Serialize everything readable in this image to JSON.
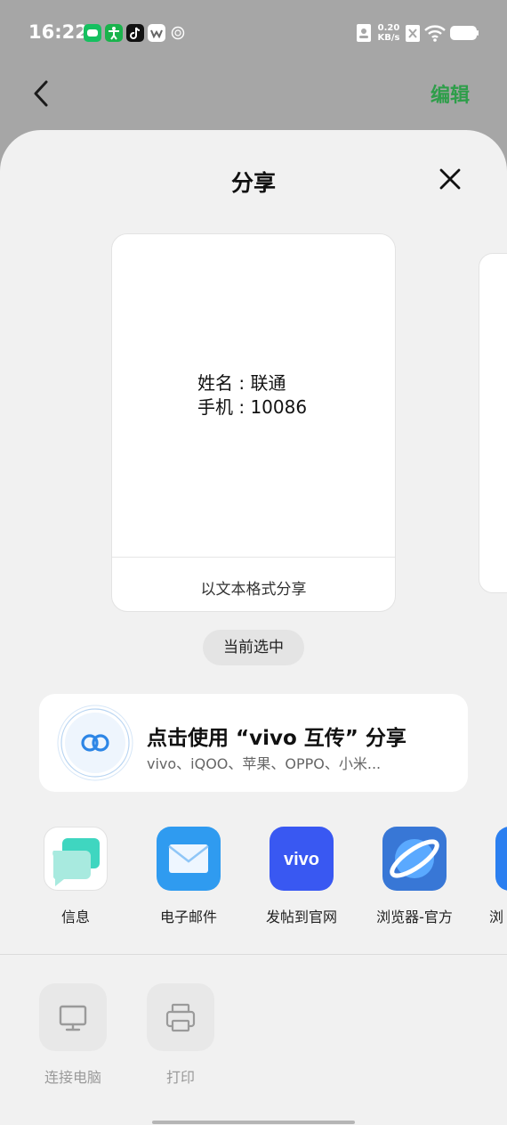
{
  "status_bar": {
    "time": "16:22",
    "net_speed_value": "0.20",
    "net_speed_unit": "KB/s",
    "app_icons": [
      "wechat-icon",
      "accessibility-icon",
      "tiktok-icon",
      "app-icon",
      "alarm-icon"
    ],
    "right_icons": [
      "contact-card-icon",
      "sim-x-icon",
      "wifi-icon",
      "battery-icon"
    ]
  },
  "header": {
    "edit_label": "编辑",
    "accent_color": "#2e9e4a"
  },
  "sheet": {
    "title": "分享",
    "card": {
      "name_line": "姓名 : 联通",
      "phone_line": "手机 : 10086",
      "footer_label": "以文本格式分享"
    },
    "selected_label": "当前选中",
    "vivo_share": {
      "title": "点击使用 “vivo 互传” 分享",
      "subtitle": "vivo、iQOO、苹果、OPPO、小米..."
    },
    "apps": [
      {
        "label": "信息",
        "icon": "messages-icon"
      },
      {
        "label": "电子邮件",
        "icon": "email-icon"
      },
      {
        "label": "发帖到官网",
        "icon": "vivo-icon",
        "text": "vivo"
      },
      {
        "label": "浏览器-官方",
        "icon": "browser-icon"
      },
      {
        "label": "浏",
        "icon": "browser-partial-icon"
      }
    ],
    "tools": [
      {
        "label": "连接电脑",
        "icon": "monitor-icon"
      },
      {
        "label": "打印",
        "icon": "printer-icon"
      }
    ]
  }
}
